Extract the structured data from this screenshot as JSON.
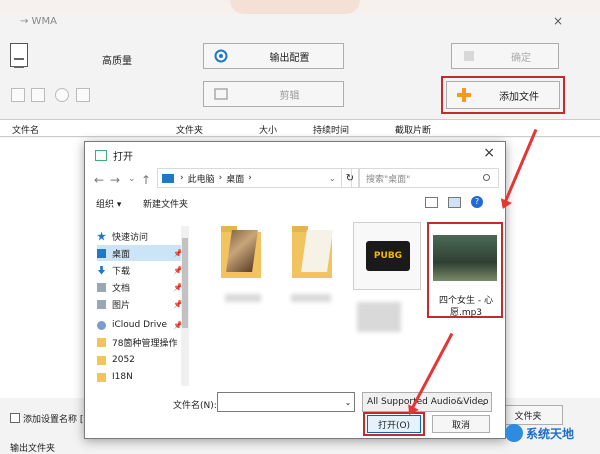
{
  "app": {
    "title": "→ WMA",
    "close_glyph": "×",
    "quality_label": "高质量",
    "output_config_label": "输出配置",
    "confirm_label": "确定",
    "cut_label": "剪辑",
    "add_file_label": "添加文件",
    "columns": [
      "文件名",
      "文件夹",
      "大小",
      "持续时间",
      "截取片断"
    ],
    "bottom_checkbox_label": "添加设置名称 [高",
    "bottom_right_button": "文件夹",
    "output_dir_label": "输出文件夹"
  },
  "dialog": {
    "title": "打开",
    "close_glyph": "×",
    "nav": {
      "back": "←",
      "forward": "→",
      "dropdown": "⌄",
      "up": "↑"
    },
    "breadcrumb": [
      "此电脑",
      "桌面"
    ],
    "breadcrumb_sep": "›",
    "refresh_glyph": "↻",
    "search_placeholder": "搜索\"桌面\"",
    "organize_label": "组织 ▾",
    "new_folder_label": "新建文件夹",
    "help_glyph": "?",
    "sidebar": [
      {
        "label": "快速访问",
        "icon": "star-icon",
        "color": "#1f78c8"
      },
      {
        "label": "桌面",
        "icon": "desktop-icon",
        "color": "#1f78c8",
        "selected": true,
        "pinned": true
      },
      {
        "label": "下载",
        "icon": "download-icon",
        "color": "#1f78c8",
        "pinned": true
      },
      {
        "label": "文档",
        "icon": "document-icon",
        "color": "#9aa7b5",
        "pinned": true
      },
      {
        "label": "图片",
        "icon": "picture-icon",
        "color": "#9aa7b5",
        "pinned": true
      },
      {
        "label": "iCloud Drive",
        "icon": "cloud-icon",
        "color": "#7a9ccf",
        "pinned": true
      },
      {
        "label": "78箇种管理操作",
        "icon": "folder-icon",
        "color": "#f2c460"
      },
      {
        "label": "2052",
        "icon": "folder-icon",
        "color": "#f2c460"
      },
      {
        "label": "I18N",
        "icon": "folder-icon",
        "color": "#f2c460"
      }
    ],
    "pin_glyph": "📌",
    "pubg_label": "PUBG",
    "mp3_name": "四个女生 - 心愿.mp3",
    "filename_label": "文件名(N):",
    "filename_value": "",
    "filetype_value": "All Supported Audio&Video",
    "open_label": "打开(O)",
    "cancel_label": "取消"
  },
  "watermark": {
    "text": "系统天地"
  },
  "colors": {
    "highlight": "#c42b2b",
    "arrow": "#e53636",
    "accent": "#1f78c8"
  }
}
